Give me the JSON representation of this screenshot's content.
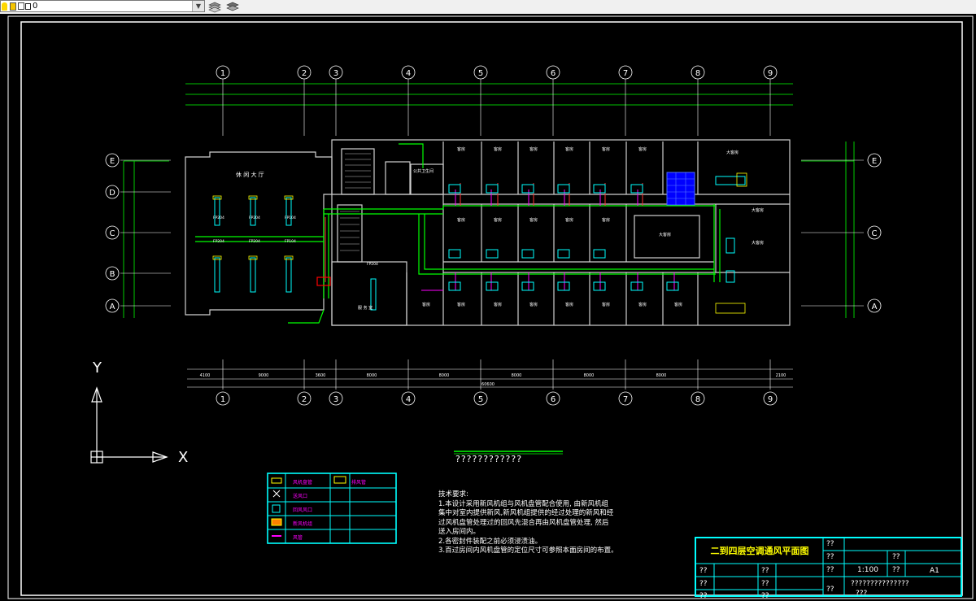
{
  "toolbar": {
    "layer_value": "0",
    "layer_dropdown": "layer-combobox"
  },
  "drawing": {
    "column_labels": [
      "1",
      "2",
      "3",
      "4",
      "5",
      "6",
      "7",
      "8",
      "9"
    ],
    "row_labels": [
      "E",
      "D",
      "C",
      "B",
      "A"
    ],
    "dims_bottom": [
      "4100",
      "9000",
      "3600",
      "8000",
      "8000",
      "8000",
      "8000",
      "8000",
      "2100"
    ],
    "dim_total": "60600",
    "hall_name": "休 闲 大 厅",
    "fp_labels": [
      "FP204",
      "FP204",
      "FP104",
      "FP204",
      "FP204",
      "FP104",
      "FP204"
    ],
    "room_label": "客房",
    "big_room_label": "大客房",
    "corridor_label": "服 务 室",
    "stair_label": "公共卫生间"
  },
  "axes": {
    "y": "Y",
    "x": "X"
  },
  "plan_title": "????????????",
  "legend": {
    "items": [
      "风机盘管",
      "送风口",
      "回风风口",
      "新风机组",
      "风管"
    ],
    "right_item": "排风管"
  },
  "notes": {
    "heading": "技术要求:",
    "lines": [
      "1.本设计采用新风机组与风机盘管配合使用, 由新风机组",
      "集中对室内提供新风,新风机组提供的经过处理的新风和经",
      "过风机盘管处理过的回风先混合再由风机盘管处理, 然后",
      "送入房间内。",
      "2.各密封件装配之前必须浸渍油。",
      "3.百过房间内风机盘管的定位尺寸可参照本面房间的布置。"
    ]
  },
  "title_block": {
    "name": "二到四层空调通风平面图",
    "q": "??",
    "scale": "1:100",
    "size": "A1",
    "long_q": "???????????????",
    "short_q": "???"
  }
}
